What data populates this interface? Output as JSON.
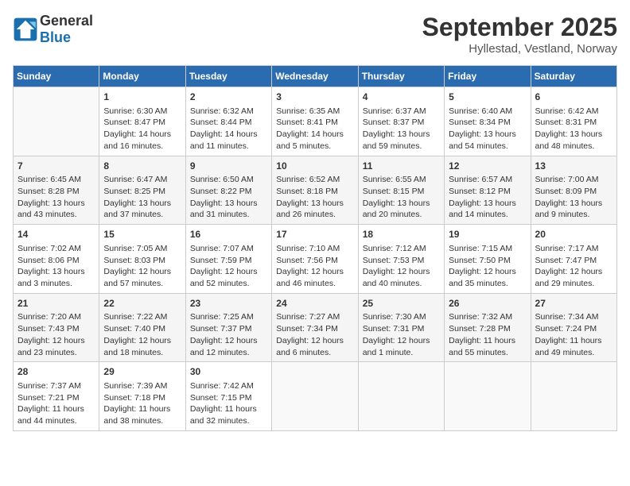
{
  "header": {
    "logo_general": "General",
    "logo_blue": "Blue",
    "month_title": "September 2025",
    "location": "Hyllestad, Vestland, Norway"
  },
  "days_of_week": [
    "Sunday",
    "Monday",
    "Tuesday",
    "Wednesday",
    "Thursday",
    "Friday",
    "Saturday"
  ],
  "weeks": [
    [
      {
        "day": "",
        "content": ""
      },
      {
        "day": "1",
        "content": "Sunrise: 6:30 AM\nSunset: 8:47 PM\nDaylight: 14 hours\nand 16 minutes."
      },
      {
        "day": "2",
        "content": "Sunrise: 6:32 AM\nSunset: 8:44 PM\nDaylight: 14 hours\nand 11 minutes."
      },
      {
        "day": "3",
        "content": "Sunrise: 6:35 AM\nSunset: 8:41 PM\nDaylight: 14 hours\nand 5 minutes."
      },
      {
        "day": "4",
        "content": "Sunrise: 6:37 AM\nSunset: 8:37 PM\nDaylight: 13 hours\nand 59 minutes."
      },
      {
        "day": "5",
        "content": "Sunrise: 6:40 AM\nSunset: 8:34 PM\nDaylight: 13 hours\nand 54 minutes."
      },
      {
        "day": "6",
        "content": "Sunrise: 6:42 AM\nSunset: 8:31 PM\nDaylight: 13 hours\nand 48 minutes."
      }
    ],
    [
      {
        "day": "7",
        "content": "Sunrise: 6:45 AM\nSunset: 8:28 PM\nDaylight: 13 hours\nand 43 minutes."
      },
      {
        "day": "8",
        "content": "Sunrise: 6:47 AM\nSunset: 8:25 PM\nDaylight: 13 hours\nand 37 minutes."
      },
      {
        "day": "9",
        "content": "Sunrise: 6:50 AM\nSunset: 8:22 PM\nDaylight: 13 hours\nand 31 minutes."
      },
      {
        "day": "10",
        "content": "Sunrise: 6:52 AM\nSunset: 8:18 PM\nDaylight: 13 hours\nand 26 minutes."
      },
      {
        "day": "11",
        "content": "Sunrise: 6:55 AM\nSunset: 8:15 PM\nDaylight: 13 hours\nand 20 minutes."
      },
      {
        "day": "12",
        "content": "Sunrise: 6:57 AM\nSunset: 8:12 PM\nDaylight: 13 hours\nand 14 minutes."
      },
      {
        "day": "13",
        "content": "Sunrise: 7:00 AM\nSunset: 8:09 PM\nDaylight: 13 hours\nand 9 minutes."
      }
    ],
    [
      {
        "day": "14",
        "content": "Sunrise: 7:02 AM\nSunset: 8:06 PM\nDaylight: 13 hours\nand 3 minutes."
      },
      {
        "day": "15",
        "content": "Sunrise: 7:05 AM\nSunset: 8:03 PM\nDaylight: 12 hours\nand 57 minutes."
      },
      {
        "day": "16",
        "content": "Sunrise: 7:07 AM\nSunset: 7:59 PM\nDaylight: 12 hours\nand 52 minutes."
      },
      {
        "day": "17",
        "content": "Sunrise: 7:10 AM\nSunset: 7:56 PM\nDaylight: 12 hours\nand 46 minutes."
      },
      {
        "day": "18",
        "content": "Sunrise: 7:12 AM\nSunset: 7:53 PM\nDaylight: 12 hours\nand 40 minutes."
      },
      {
        "day": "19",
        "content": "Sunrise: 7:15 AM\nSunset: 7:50 PM\nDaylight: 12 hours\nand 35 minutes."
      },
      {
        "day": "20",
        "content": "Sunrise: 7:17 AM\nSunset: 7:47 PM\nDaylight: 12 hours\nand 29 minutes."
      }
    ],
    [
      {
        "day": "21",
        "content": "Sunrise: 7:20 AM\nSunset: 7:43 PM\nDaylight: 12 hours\nand 23 minutes."
      },
      {
        "day": "22",
        "content": "Sunrise: 7:22 AM\nSunset: 7:40 PM\nDaylight: 12 hours\nand 18 minutes."
      },
      {
        "day": "23",
        "content": "Sunrise: 7:25 AM\nSunset: 7:37 PM\nDaylight: 12 hours\nand 12 minutes."
      },
      {
        "day": "24",
        "content": "Sunrise: 7:27 AM\nSunset: 7:34 PM\nDaylight: 12 hours\nand 6 minutes."
      },
      {
        "day": "25",
        "content": "Sunrise: 7:30 AM\nSunset: 7:31 PM\nDaylight: 12 hours\nand 1 minute."
      },
      {
        "day": "26",
        "content": "Sunrise: 7:32 AM\nSunset: 7:28 PM\nDaylight: 11 hours\nand 55 minutes."
      },
      {
        "day": "27",
        "content": "Sunrise: 7:34 AM\nSunset: 7:24 PM\nDaylight: 11 hours\nand 49 minutes."
      }
    ],
    [
      {
        "day": "28",
        "content": "Sunrise: 7:37 AM\nSunset: 7:21 PM\nDaylight: 11 hours\nand 44 minutes."
      },
      {
        "day": "29",
        "content": "Sunrise: 7:39 AM\nSunset: 7:18 PM\nDaylight: 11 hours\nand 38 minutes."
      },
      {
        "day": "30",
        "content": "Sunrise: 7:42 AM\nSunset: 7:15 PM\nDaylight: 11 hours\nand 32 minutes."
      },
      {
        "day": "",
        "content": ""
      },
      {
        "day": "",
        "content": ""
      },
      {
        "day": "",
        "content": ""
      },
      {
        "day": "",
        "content": ""
      }
    ]
  ]
}
